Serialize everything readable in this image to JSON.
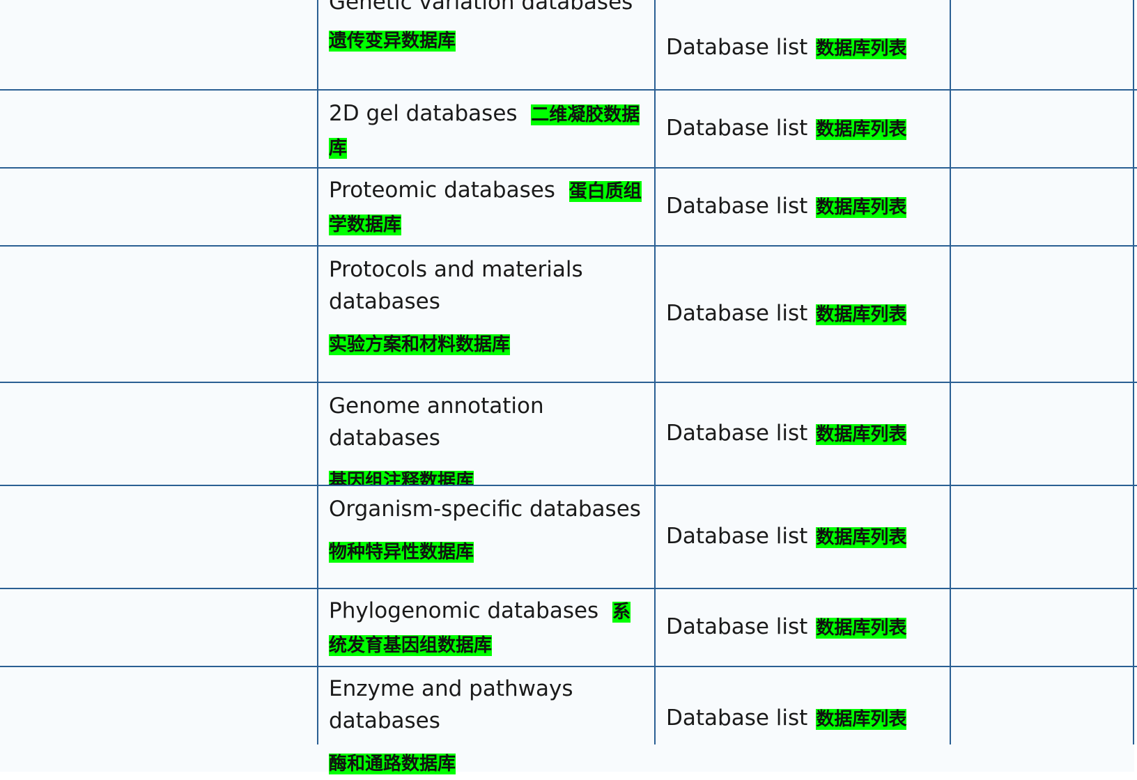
{
  "rows": [
    {
      "en": "Genetic variation databases",
      "zh": "遗传变异数据库",
      "list_label": "Database list",
      "list_zh": "数据库列表"
    },
    {
      "en": "2D gel databases",
      "zh": "二维凝胶数据库",
      "list_label": "Database list",
      "list_zh": "数据库列表"
    },
    {
      "en": "Proteomic databases",
      "zh": "蛋白质组学数据库",
      "list_label": "Database list",
      "list_zh": "数据库列表"
    },
    {
      "en": "Protocols and materials databases",
      "zh": "实验方案和材料数据库",
      "list_label": "Database list",
      "list_zh": "数据库列表"
    },
    {
      "en": "Genome annotation databases",
      "zh": "基因组注释数据库",
      "list_label": "Database list",
      "list_zh": "数据库列表"
    },
    {
      "en": "Organism-specific databases",
      "zh": "物种特异性数据库",
      "list_label": "Database list",
      "list_zh": "数据库列表"
    },
    {
      "en": "Phylogenomic databases",
      "zh": "系统发育基因组数据库",
      "list_label": "Database list",
      "list_zh": "数据库列表"
    },
    {
      "en": "Enzyme and pathways databases",
      "zh": "酶和通路数据库",
      "list_label": "Database list",
      "list_zh": "数据库列表"
    }
  ],
  "colors": {
    "border": "#2a5f93",
    "highlight": "#00ff00",
    "cell_bg": "#f8fbfd"
  }
}
